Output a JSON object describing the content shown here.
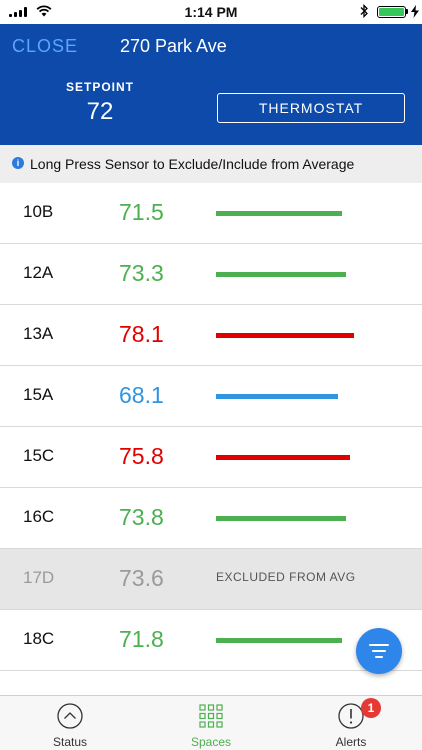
{
  "status_bar": {
    "time": "1:14 PM"
  },
  "header": {
    "close_label": "CLOSE",
    "title": "270 Park Ave",
    "setpoint_label": "SETPOINT",
    "setpoint_value": "72",
    "thermostat_label": "THERMOSTAT"
  },
  "info": {
    "text": "Long Press Sensor to Exclude/Include from Average"
  },
  "colors": {
    "header_bg": "#0e4aa9",
    "normal": "#4caf50",
    "hot": "#e00000",
    "cold": "#2f95e0",
    "excluded": "#9a9a9a"
  },
  "sensors": [
    {
      "name": "10B",
      "temp": "71.5",
      "status": "normal",
      "level": 0.61
    },
    {
      "name": "12A",
      "temp": "73.3",
      "status": "normal",
      "level": 0.63
    },
    {
      "name": "13A",
      "temp": "78.1",
      "status": "hot",
      "level": 0.67
    },
    {
      "name": "15A",
      "temp": "68.1",
      "status": "cold",
      "level": 0.59
    },
    {
      "name": "15C",
      "temp": "75.8",
      "status": "hot",
      "level": 0.65
    },
    {
      "name": "16C",
      "temp": "73.8",
      "status": "normal",
      "level": 0.63
    },
    {
      "name": "17D",
      "temp": "73.6",
      "status": "excluded",
      "excluded_label": "EXCLUDED FROM AVG"
    },
    {
      "name": "18C",
      "temp": "71.8",
      "status": "normal",
      "level": 0.61
    }
  ],
  "tabs": [
    {
      "label": "Status",
      "icon": "chevron-up-circle-icon",
      "active": false
    },
    {
      "label": "Spaces",
      "icon": "grid-icon",
      "active": true
    },
    {
      "label": "Alerts",
      "icon": "alert-circle-icon",
      "active": false,
      "badge": "1"
    }
  ]
}
